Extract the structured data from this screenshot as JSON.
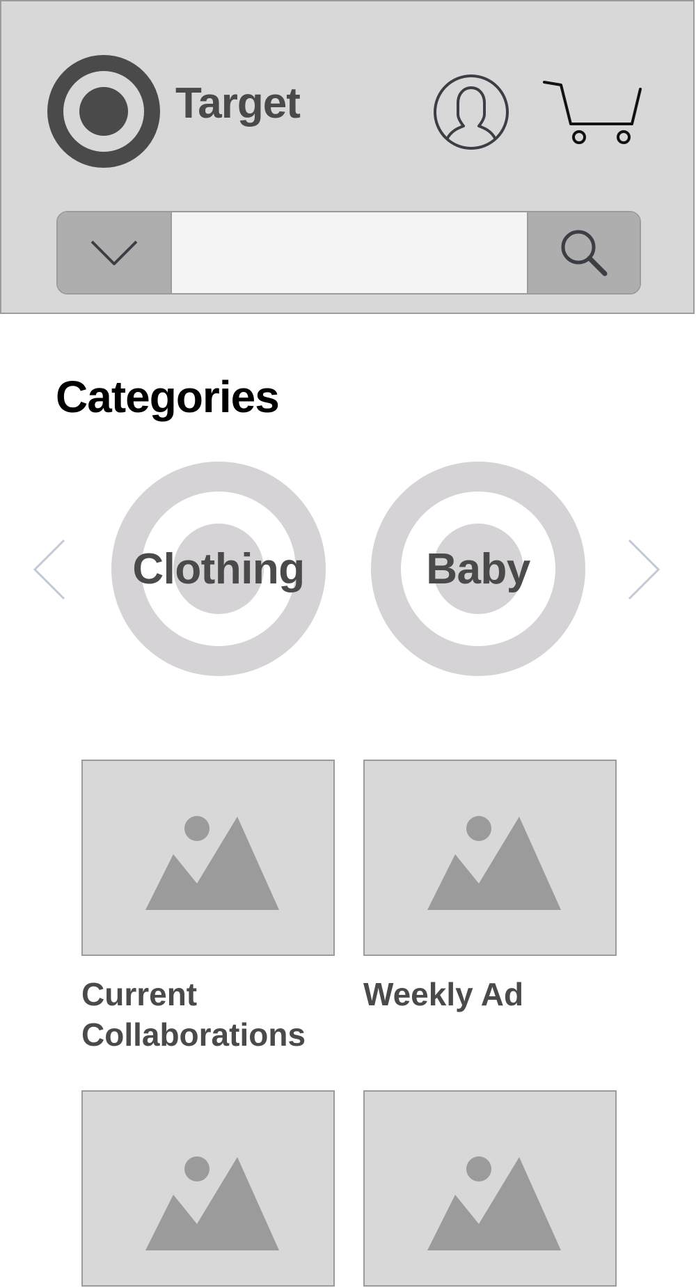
{
  "header": {
    "brand_name": "Target",
    "search": {
      "value": "",
      "placeholder": ""
    },
    "icons": {
      "logo": "bullseye-logo-icon",
      "account": "user-account-icon",
      "cart": "shopping-cart-icon",
      "dropdown": "chevron-down-icon",
      "search": "search-icon"
    }
  },
  "categories": {
    "title": "Categories",
    "items": [
      {
        "label": "Clothing"
      },
      {
        "label": "Baby"
      }
    ],
    "icons": {
      "prev": "chevron-left-icon",
      "next": "chevron-right-icon"
    }
  },
  "promos": [
    {
      "label": "Current Collaborations",
      "image": "image-placeholder-icon"
    },
    {
      "label": "Weekly Ad",
      "image": "image-placeholder-icon"
    },
    {
      "label": "",
      "image": "image-placeholder-icon"
    },
    {
      "label": "",
      "image": "image-placeholder-icon"
    }
  ],
  "colors": {
    "header_bg": "#d8d8d8",
    "border": "#9b9b9b",
    "dark_text": "#4a4a4a",
    "button_bg": "#aeaeae",
    "category_ring": "#d5d3d5",
    "arrow": "#c2c8d6"
  }
}
